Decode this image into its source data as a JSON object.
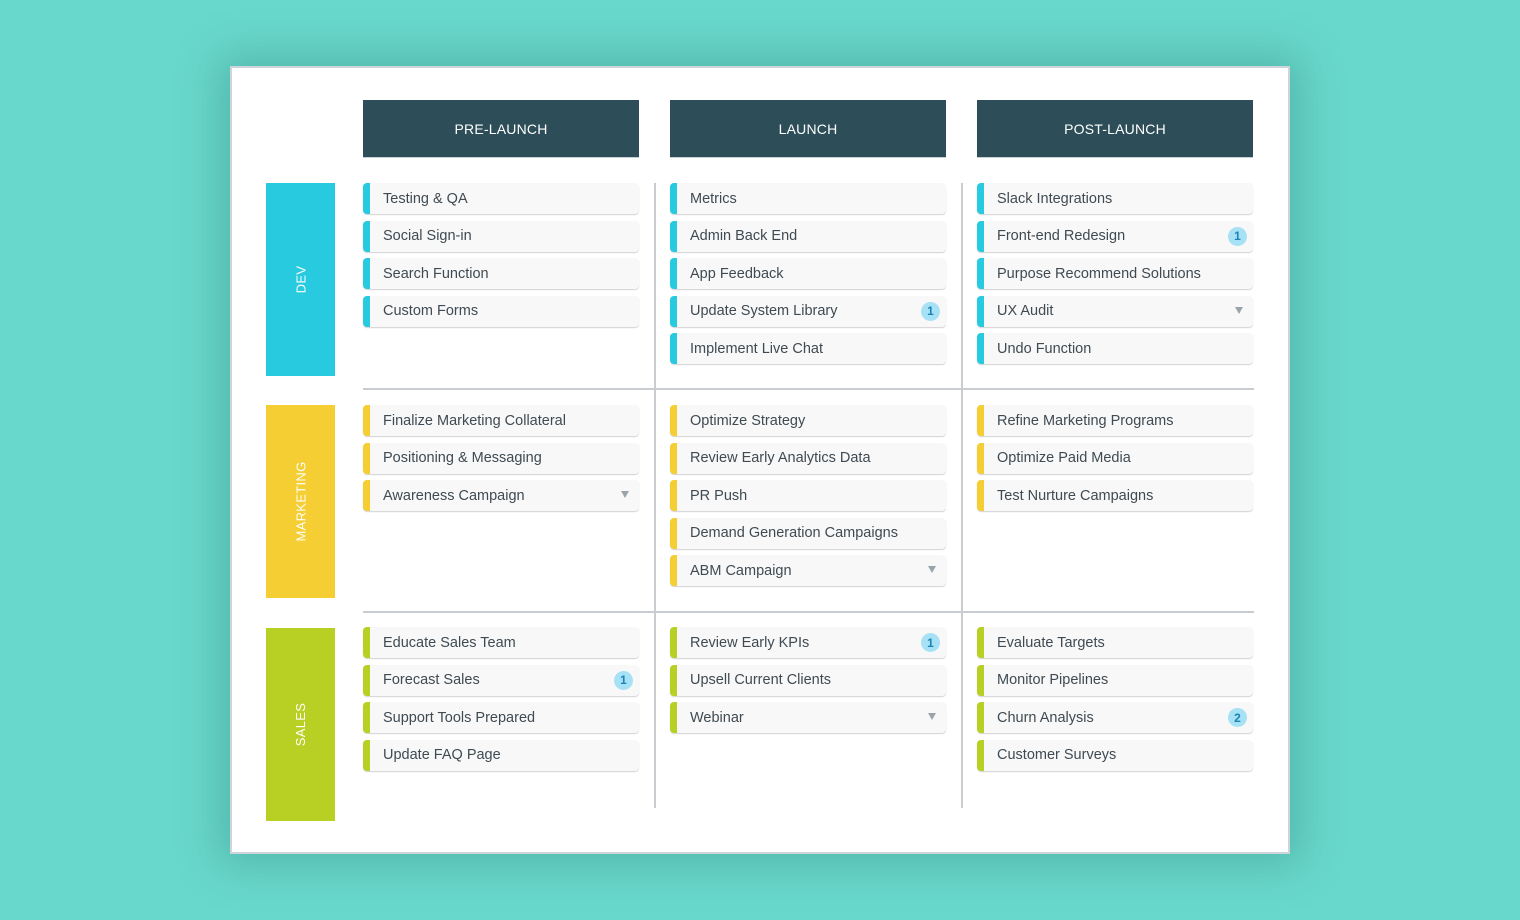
{
  "columns": [
    {
      "label": "PRE-LAUNCH"
    },
    {
      "label": "LAUNCH"
    },
    {
      "label": "POST-LAUNCH"
    }
  ],
  "rows": [
    {
      "label": "DEV",
      "color": "#27cadf"
    },
    {
      "label": "MARKETING",
      "color": "#f4ce32"
    },
    {
      "label": "SALES",
      "color": "#b8cf23"
    }
  ],
  "badge_color": "#a7e1f5",
  "header_color": "#2d4e58",
  "cells": [
    [
      [
        {
          "label": "Testing & QA"
        },
        {
          "label": "Social Sign-in"
        },
        {
          "label": "Search Function"
        },
        {
          "label": "Custom Forms"
        }
      ],
      [
        {
          "label": "Metrics"
        },
        {
          "label": "Admin Back End"
        },
        {
          "label": "App Feedback"
        },
        {
          "label": "Update System Library",
          "badge": "1"
        },
        {
          "label": "Implement Live Chat"
        }
      ],
      [
        {
          "label": "Slack Integrations"
        },
        {
          "label": "Front-end Redesign",
          "badge": "1"
        },
        {
          "label": "Purpose Recommend Solutions"
        },
        {
          "label": "UX Audit",
          "dropdown": true
        },
        {
          "label": "Undo Function"
        }
      ]
    ],
    [
      [
        {
          "label": "Finalize Marketing Collateral"
        },
        {
          "label": "Positioning & Messaging"
        },
        {
          "label": "Awareness Campaign",
          "dropdown": true
        }
      ],
      [
        {
          "label": "Optimize Strategy"
        },
        {
          "label": "Review Early Analytics Data"
        },
        {
          "label": "PR Push"
        },
        {
          "label": "Demand Generation Campaigns"
        },
        {
          "label": "ABM Campaign",
          "dropdown": true
        }
      ],
      [
        {
          "label": "Refine Marketing Programs"
        },
        {
          "label": "Optimize Paid Media"
        },
        {
          "label": "Test Nurture Campaigns"
        }
      ]
    ],
    [
      [
        {
          "label": "Educate Sales Team"
        },
        {
          "label": "Forecast Sales",
          "badge": "1"
        },
        {
          "label": "Support Tools Prepared"
        },
        {
          "label": "Update FAQ Page"
        }
      ],
      [
        {
          "label": "Review Early KPIs",
          "badge": "1"
        },
        {
          "label": "Upsell Current Clients"
        },
        {
          "label": "Webinar",
          "dropdown": true
        }
      ],
      [
        {
          "label": "Evaluate Targets"
        },
        {
          "label": "Monitor Pipelines"
        },
        {
          "label": "Churn Analysis",
          "badge": "2"
        },
        {
          "label": "Customer Surveys"
        }
      ]
    ]
  ]
}
